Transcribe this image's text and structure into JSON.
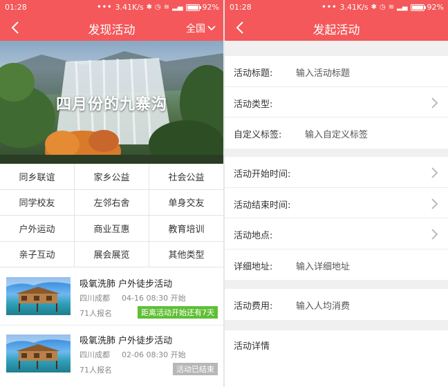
{
  "colors": {
    "brand": "#f4585a",
    "badge_active": "#5fbf35",
    "badge_ended": "#b7b7b7"
  },
  "left": {
    "status": {
      "time": "01:28",
      "speed": "3.41K/s",
      "battery": "92%"
    },
    "nav": {
      "back_icon": "back-arrow-icon",
      "title": "发现活动",
      "region": "全国",
      "region_icon": "chevron-down-icon"
    },
    "banner": {
      "caption": "四月份的九寨沟"
    },
    "categories": [
      "同乡联谊",
      "家乡公益",
      "社会公益",
      "同学校友",
      "左邻右舍",
      "单身交友",
      "户外运动",
      "商业互惠",
      "教育培训",
      "亲子互动",
      "展会展览",
      "其他类型"
    ],
    "activities": [
      {
        "title": "吸氧洗肺 户外徒步活动",
        "location": "四川成都",
        "time": "04-16 08:30 开始",
        "signup": "71人报名",
        "badge": "距离活动开始还有7天",
        "badge_style": "green"
      },
      {
        "title": "吸氧洗肺 户外徒步活动",
        "location": "四川成都",
        "time": "02-06 08:30 开始",
        "signup": "71人报名",
        "badge": "活动已结束",
        "badge_style": "gray"
      }
    ]
  },
  "right": {
    "status": {
      "time": "01:28",
      "speed": "3.41K/s",
      "battery": "92%"
    },
    "nav": {
      "back_icon": "back-arrow-icon",
      "title": "发起活动"
    },
    "groups": [
      [
        {
          "label": "活动标题:",
          "placeholder": "输入活动标题",
          "chevron": false
        },
        {
          "label": "活动类型:",
          "placeholder": "",
          "chevron": true
        },
        {
          "label": "自定义标签:",
          "placeholder": "输入自定义标签",
          "chevron": false
        }
      ],
      [
        {
          "label": "活动开始时间:",
          "placeholder": "",
          "chevron": true
        },
        {
          "label": "活动结束时间:",
          "placeholder": "",
          "chevron": true
        },
        {
          "label": "活动地点:",
          "placeholder": "",
          "chevron": true
        },
        {
          "label": "详细地址:",
          "placeholder": "输入详细地址",
          "chevron": false
        }
      ],
      [
        {
          "label": "活动费用:",
          "placeholder": "输入人均消费",
          "chevron": false
        }
      ]
    ],
    "detail_label": "活动详情"
  }
}
